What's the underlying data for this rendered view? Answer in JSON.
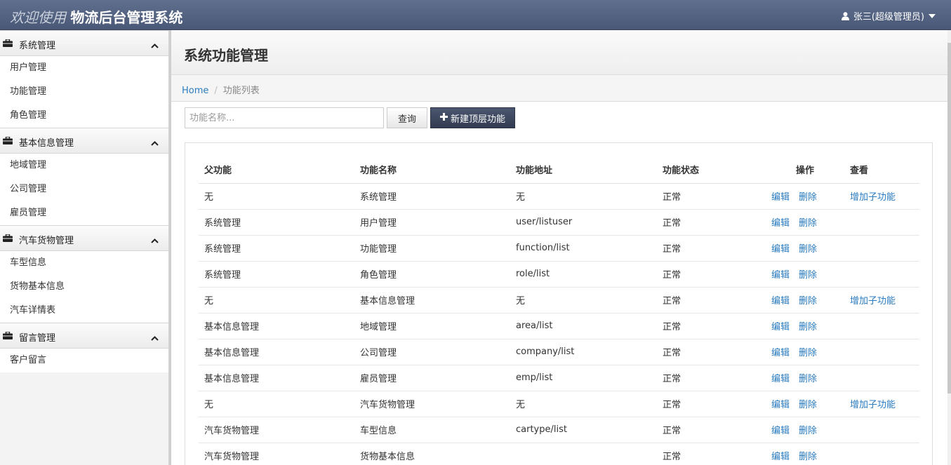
{
  "header": {
    "welcome": "欢迎使用",
    "system_name": "物流后台管理系统",
    "user": "张三(超级管理员)",
    "user_icon": "user-icon",
    "caret_icon": "caret-down-icon"
  },
  "sidebar": {
    "groups": [
      {
        "title": "系统管理",
        "items": [
          "用户管理",
          "功能管理",
          "角色管理"
        ]
      },
      {
        "title": "基本信息管理",
        "items": [
          "地域管理",
          "公司管理",
          "雇员管理"
        ]
      },
      {
        "title": "汽车货物管理",
        "items": [
          "车型信息",
          "货物基本信息",
          "汽车详情表"
        ]
      },
      {
        "title": "留言管理",
        "items": [
          "客户留言"
        ]
      }
    ]
  },
  "page": {
    "title": "系统功能管理",
    "breadcrumb": {
      "home": "Home",
      "current": "功能列表"
    }
  },
  "toolbar": {
    "search_placeholder": "功能名称...",
    "query_label": "查询",
    "new_label": "新建顶层功能"
  },
  "table": {
    "headers": [
      "父功能",
      "功能名称",
      "功能地址",
      "功能状态",
      "操作",
      "查看"
    ],
    "edit_label": "编辑",
    "delete_label": "删除",
    "add_child_label": "增加子功能",
    "rows": [
      {
        "parent": "无",
        "name": "系统管理",
        "url": "无",
        "status": "正常",
        "has_child_link": true
      },
      {
        "parent": "系统管理",
        "name": "用户管理",
        "url": "user/listuser",
        "status": "正常",
        "has_child_link": false
      },
      {
        "parent": "系统管理",
        "name": "功能管理",
        "url": "function/list",
        "status": "正常",
        "has_child_link": false
      },
      {
        "parent": "系统管理",
        "name": "角色管理",
        "url": "role/list",
        "status": "正常",
        "has_child_link": false
      },
      {
        "parent": "无",
        "name": "基本信息管理",
        "url": "无",
        "status": "正常",
        "has_child_link": true
      },
      {
        "parent": "基本信息管理",
        "name": "地域管理",
        "url": "area/list",
        "status": "正常",
        "has_child_link": false
      },
      {
        "parent": "基本信息管理",
        "name": "公司管理",
        "url": "company/list",
        "status": "正常",
        "has_child_link": false
      },
      {
        "parent": "基本信息管理",
        "name": "雇员管理",
        "url": "emp/list",
        "status": "正常",
        "has_child_link": false
      },
      {
        "parent": "无",
        "name": "汽车货物管理",
        "url": "无",
        "status": "正常",
        "has_child_link": true
      },
      {
        "parent": "汽车货物管理",
        "name": "车型信息",
        "url": "cartype/list",
        "status": "正常",
        "has_child_link": false
      },
      {
        "parent": "汽车货物管理",
        "name": "货物基本信息",
        "url": "",
        "status": "正常",
        "has_child_link": false
      }
    ]
  },
  "colors": {
    "header_bg": "#4f5d7c",
    "link": "#2a7bbf",
    "primary_button": "#3a4459"
  }
}
